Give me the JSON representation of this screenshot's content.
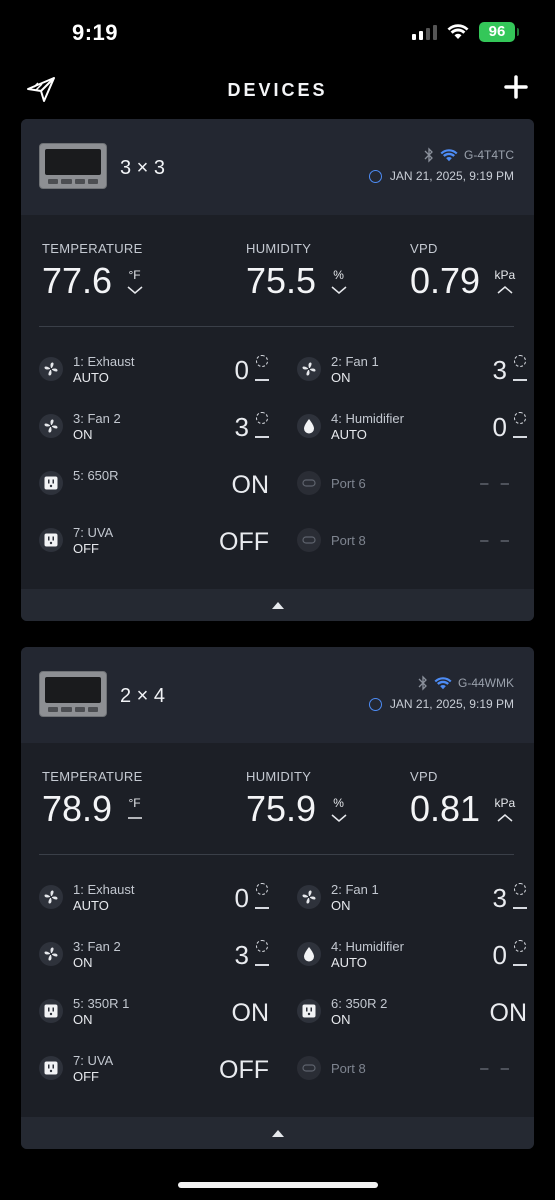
{
  "status_bar": {
    "time": "9:19",
    "battery": "96"
  },
  "nav": {
    "title": "DEVICES"
  },
  "devices": [
    {
      "name": "3 × 3",
      "device_id": "G-4T4TC",
      "timestamp": "JAN 21, 2025, 9:19 PM",
      "metrics": {
        "temperature": {
          "label": "TEMPERATURE",
          "value": "77.6",
          "unit": "°F",
          "trend": "down"
        },
        "humidity": {
          "label": "HUMIDITY",
          "value": "75.5",
          "unit": "%",
          "trend": "down"
        },
        "vpd": {
          "label": "VPD",
          "value": "0.79",
          "unit": "kPa",
          "trend": "up"
        }
      },
      "ports": [
        {
          "name": "1: Exhaust",
          "mode": "AUTO",
          "level": "0",
          "type": "fan"
        },
        {
          "name": "2: Fan 1",
          "mode": "ON",
          "level": "3",
          "type": "fan"
        },
        {
          "name": "3: Fan 2",
          "mode": "ON",
          "level": "3",
          "type": "fan"
        },
        {
          "name": "4: Humidifier",
          "mode": "AUTO",
          "level": "0",
          "type": "humidifier"
        },
        {
          "name": "5: 650R",
          "mode": "",
          "level": "ON",
          "type": "outlet"
        },
        {
          "name": "Port 6",
          "mode": "",
          "level": "– –",
          "type": "empty"
        },
        {
          "name": "7: UVA",
          "mode": "OFF",
          "level": "OFF",
          "type": "outlet"
        },
        {
          "name": "Port 8",
          "mode": "",
          "level": "– –",
          "type": "empty"
        }
      ]
    },
    {
      "name": "2 × 4",
      "device_id": "G-44WMK",
      "timestamp": "JAN 21, 2025, 9:19 PM",
      "metrics": {
        "temperature": {
          "label": "TEMPERATURE",
          "value": "78.9",
          "unit": "°F",
          "trend": "flat"
        },
        "humidity": {
          "label": "HUMIDITY",
          "value": "75.9",
          "unit": "%",
          "trend": "down"
        },
        "vpd": {
          "label": "VPD",
          "value": "0.81",
          "unit": "kPa",
          "trend": "up"
        }
      },
      "ports": [
        {
          "name": "1: Exhaust",
          "mode": "AUTO",
          "level": "0",
          "type": "fan"
        },
        {
          "name": "2: Fan 1",
          "mode": "ON",
          "level": "3",
          "type": "fan"
        },
        {
          "name": "3: Fan 2",
          "mode": "ON",
          "level": "3",
          "type": "fan"
        },
        {
          "name": "4: Humidifier",
          "mode": "AUTO",
          "level": "0",
          "type": "humidifier"
        },
        {
          "name": "5: 350R 1",
          "mode": "ON",
          "level": "ON",
          "type": "outlet"
        },
        {
          "name": "6: 350R 2",
          "mode": "ON",
          "level": "ON",
          "type": "outlet"
        },
        {
          "name": "7: UVA",
          "mode": "OFF",
          "level": "OFF",
          "type": "outlet"
        },
        {
          "name": "Port 8",
          "mode": "",
          "level": "– –",
          "type": "empty"
        }
      ]
    }
  ],
  "colors": {
    "accent": "#4d8cf5",
    "battery": "#34c759",
    "card": "#1c1f26",
    "card_header": "#232731"
  },
  "icons": [
    "app-logo-icon",
    "add-icon",
    "bluetooth-icon",
    "wifi-icon",
    "clock-icon",
    "fan-icon",
    "droplet-icon",
    "outlet-icon",
    "empty-port-icon",
    "collapse-icon"
  ]
}
